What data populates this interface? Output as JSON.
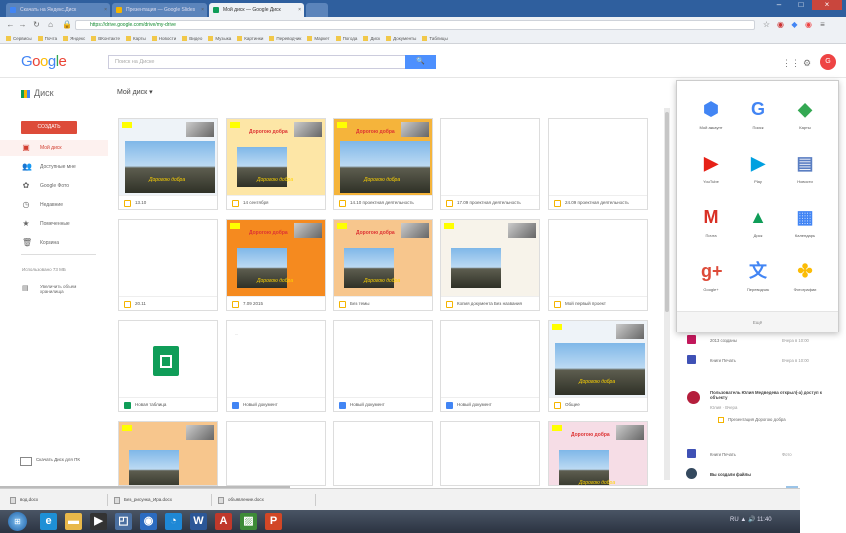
{
  "browser": {
    "tabs": [
      {
        "label": "Скачать на Яндекс.Диск",
        "active": false
      },
      {
        "label": "Презентация — Google Slides",
        "active": false
      },
      {
        "label": "Мой диск — Google Диск",
        "active": true
      },
      {
        "label": "",
        "active": false
      }
    ],
    "window_buttons": [
      "–",
      "□",
      "×"
    ],
    "nav_icons": [
      "back-icon",
      "forward-icon",
      "reload-icon",
      "home-icon"
    ],
    "url": "https://drive.google.com/drive/my-drive",
    "bookmarks": [
      "Сервисы",
      "Почта",
      "Яндекс",
      "ВКонтакте",
      "Карты",
      "Новости",
      "Видео",
      "Музыка",
      "Картинки",
      "Переводчик",
      "Маркет",
      "Погода",
      "Диск",
      "Документы",
      "Таблицы"
    ]
  },
  "google_bar": {
    "logo": "Google",
    "search_placeholder": "Поиск на Диске",
    "search_button": "🔍",
    "icons": [
      "apps-grid-icon",
      "notifications-icon"
    ],
    "avatar_letter": "G"
  },
  "drive": {
    "logo_label": "Диск",
    "breadcrumb": "Мой диск ▾"
  },
  "sidebar": {
    "new_button": "СОЗДАТЬ",
    "items": [
      {
        "icon": "my-drive-icon",
        "glyph": "▣",
        "label": "Мой диск",
        "selected": true
      },
      {
        "icon": "shared-icon",
        "glyph": "👥",
        "label": "Доступные мне",
        "selected": false
      },
      {
        "icon": "photos-icon",
        "glyph": "✿",
        "label": "Google Фото",
        "selected": false
      },
      {
        "icon": "recent-icon",
        "glyph": "◷",
        "label": "Недавние",
        "selected": false
      },
      {
        "icon": "starred-icon",
        "glyph": "★",
        "label": "Помеченные",
        "selected": false
      },
      {
        "icon": "trash-icon",
        "glyph": "🗑",
        "label": "Корзина",
        "selected": false
      }
    ],
    "storage_text": "Использовано 73 МБ",
    "storage_upgrade": "Увеличить объем хранилища",
    "get_drive": "Скачать Диск для ПК"
  },
  "files": [
    {
      "name": "13.10",
      "type": "slides",
      "thumb": "photo"
    },
    {
      "name": "14 сентября",
      "type": "slides",
      "thumb": "yellow"
    },
    {
      "name": "14.10 проектная деятельность",
      "type": "slides",
      "thumb": "orange"
    },
    {
      "name": "17.09 проектная деятельность",
      "type": "slides",
      "thumb": "blank"
    },
    {
      "name": "24.09 проектная деятельность",
      "type": "slides",
      "thumb": "blank"
    },
    {
      "name": "20.11",
      "type": "slides",
      "thumb": "blank"
    },
    {
      "name": "7.09 2015",
      "type": "slides",
      "thumb": "orange2"
    },
    {
      "name": "Без темы",
      "type": "slides",
      "thumb": "peach"
    },
    {
      "name": "Копия документа Без названия",
      "type": "slides",
      "thumb": "photo2"
    },
    {
      "name": "Мой первый проект",
      "type": "slides",
      "thumb": "blank"
    },
    {
      "name": "Новая таблица",
      "type": "sheets",
      "thumb": "sheet"
    },
    {
      "name": "Новый документ",
      "type": "docs",
      "thumb": "doc"
    },
    {
      "name": "Новый документ",
      "type": "docs",
      "thumb": "blank"
    },
    {
      "name": "Новый документ",
      "type": "docs",
      "thumb": "blank"
    },
    {
      "name": "Общее",
      "type": "slides",
      "thumb": "photo3"
    },
    {
      "name": "",
      "type": "slides",
      "thumb": "peach2"
    },
    {
      "name": "",
      "type": "docs",
      "thumb": "blank"
    },
    {
      "name": "",
      "type": "docs",
      "thumb": "blank"
    },
    {
      "name": "",
      "type": "docs",
      "thumb": "blank"
    },
    {
      "name": "",
      "type": "slides",
      "thumb": "pink"
    }
  ],
  "slide_text": {
    "title": "Дорогою добра",
    "subtitle": "Дорогою добра"
  },
  "apps_panel": {
    "apps": [
      {
        "label": "Мой аккаунт",
        "icon": "account-icon",
        "glyph": "⬢",
        "color": "#4285f4"
      },
      {
        "label": "Поиск",
        "icon": "search-app-icon",
        "glyph": "G",
        "color": "#4285f4"
      },
      {
        "label": "Карты",
        "icon": "maps-icon",
        "glyph": "◆",
        "color": "#34a853"
      },
      {
        "label": "YouTube",
        "icon": "youtube-icon",
        "glyph": "▶",
        "color": "#e62117"
      },
      {
        "label": "Play",
        "icon": "play-icon",
        "glyph": "▶",
        "color": "#00a0e0"
      },
      {
        "label": "Новости",
        "icon": "news-icon",
        "glyph": "▤",
        "color": "#5a7ec2"
      },
      {
        "label": "Почта",
        "icon": "gmail-icon",
        "glyph": "M",
        "color": "#d93025"
      },
      {
        "label": "Диск",
        "icon": "drive-icon",
        "glyph": "▲",
        "color": "#0f9d58"
      },
      {
        "label": "Календарь",
        "icon": "calendar-icon",
        "glyph": "▦",
        "color": "#4285f4"
      },
      {
        "label": "Google+",
        "icon": "gplus-icon",
        "glyph": "g+",
        "color": "#dd4b39"
      },
      {
        "label": "Переводчик",
        "icon": "translate-icon",
        "glyph": "文",
        "color": "#4285f4"
      },
      {
        "label": "Фотографии",
        "icon": "photos-app-icon",
        "glyph": "✤",
        "color": "#fbbc05"
      }
    ],
    "more": "Ещё"
  },
  "activity": {
    "rows": [
      {
        "icon_color": "#c2185b",
        "text": "2013 созданы",
        "time": "Вчера в 10:00"
      },
      {
        "icon_color": "#3f51b5",
        "text": "Книги Печать",
        "time": "Вчера в 10:00"
      }
    ],
    "persona_title": "Пользователь Юлия Медведева открыл(-а) доступ к объекту",
    "persona_date": "Юлия · Вчера",
    "persona_file": "Презентация Дорогою добра",
    "rows2": [
      {
        "icon_color": "#3f51b5",
        "text": "Книги Печать",
        "time": "Фото"
      }
    ],
    "bottom_text": "Вы создали файлы"
  },
  "downloads": [
    {
      "label": "вод.docx"
    },
    {
      "label": "Без_рисунка_Ира.docx"
    },
    {
      "label": "объявление.docx"
    }
  ],
  "taskbar": {
    "start": "⊞",
    "apps": [
      {
        "icon": "ie-icon",
        "glyph": "e",
        "color": "#1e90d6"
      },
      {
        "icon": "explorer-icon",
        "glyph": "▬",
        "color": "#e8b84a"
      },
      {
        "icon": "media-icon",
        "glyph": "▶",
        "color": "#333"
      },
      {
        "icon": "folder-icon",
        "glyph": "◰",
        "color": "#4a6fa0"
      },
      {
        "icon": "chrome-icon",
        "glyph": "◉",
        "color": "#2b6bc0"
      },
      {
        "icon": "skype-icon",
        "glyph": "◔",
        "color": "#1e88d6"
      },
      {
        "icon": "word-icon",
        "glyph": "W",
        "color": "#2b5797"
      },
      {
        "icon": "pdf-icon",
        "glyph": "A",
        "color": "#c0392b"
      },
      {
        "icon": "image-icon",
        "glyph": "▨",
        "color": "#3d8b37"
      },
      {
        "icon": "powerpoint-icon",
        "glyph": "P",
        "color": "#d24726"
      }
    ],
    "tray": "RU ▲ 🔊 11:40"
  }
}
